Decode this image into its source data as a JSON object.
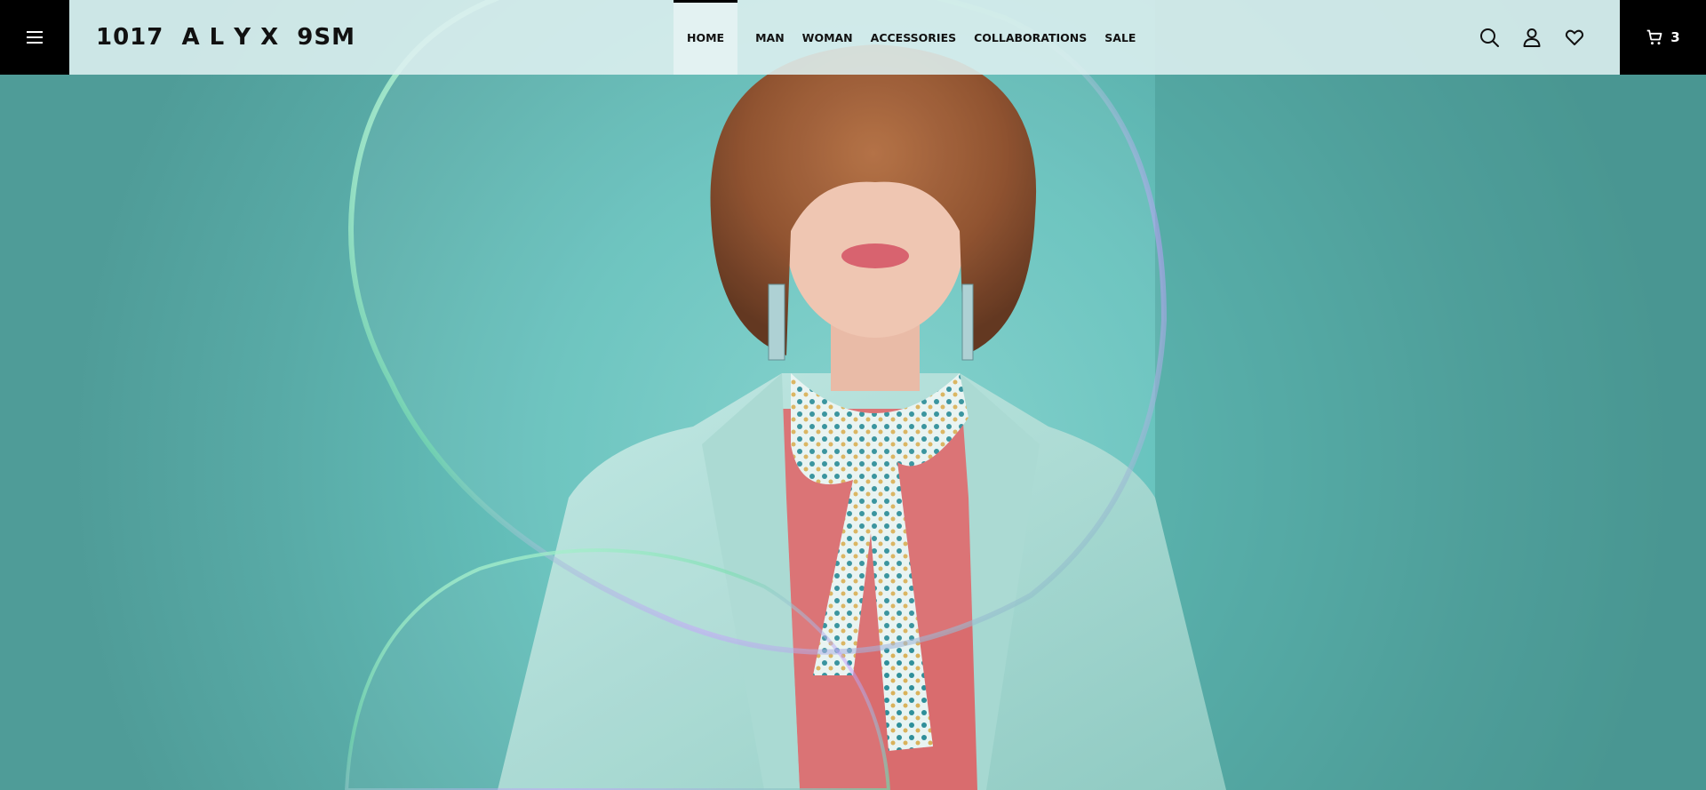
{
  "header": {
    "menu_icon": "hamburger-menu-icon",
    "logo": "1017  A L Y X  9SM",
    "nav": [
      {
        "label": "HOME",
        "active": true
      },
      {
        "label": "MAN",
        "active": false
      },
      {
        "label": "WOMAN",
        "active": false
      },
      {
        "label": "ACCESSORIES",
        "active": false
      },
      {
        "label": "COLLABORATIONS",
        "active": false
      },
      {
        "label": "SALE",
        "active": false
      }
    ],
    "icons": [
      "search-icon",
      "account-icon",
      "wishlist-heart-icon"
    ],
    "cart": {
      "icon": "cart-icon",
      "count": "3"
    }
  },
  "hero": {
    "image": "fashion model with bob haircut, mint blazer, patterned scarf and soap bubbles on teal background"
  },
  "colors": {
    "header_bg": "#DEF0F0",
    "dark": "#000000",
    "teal_bg": "#5FB6B1",
    "blazer": "#A8DBD4",
    "sweater": "#D96C6E",
    "hair": "#8B4A25"
  }
}
